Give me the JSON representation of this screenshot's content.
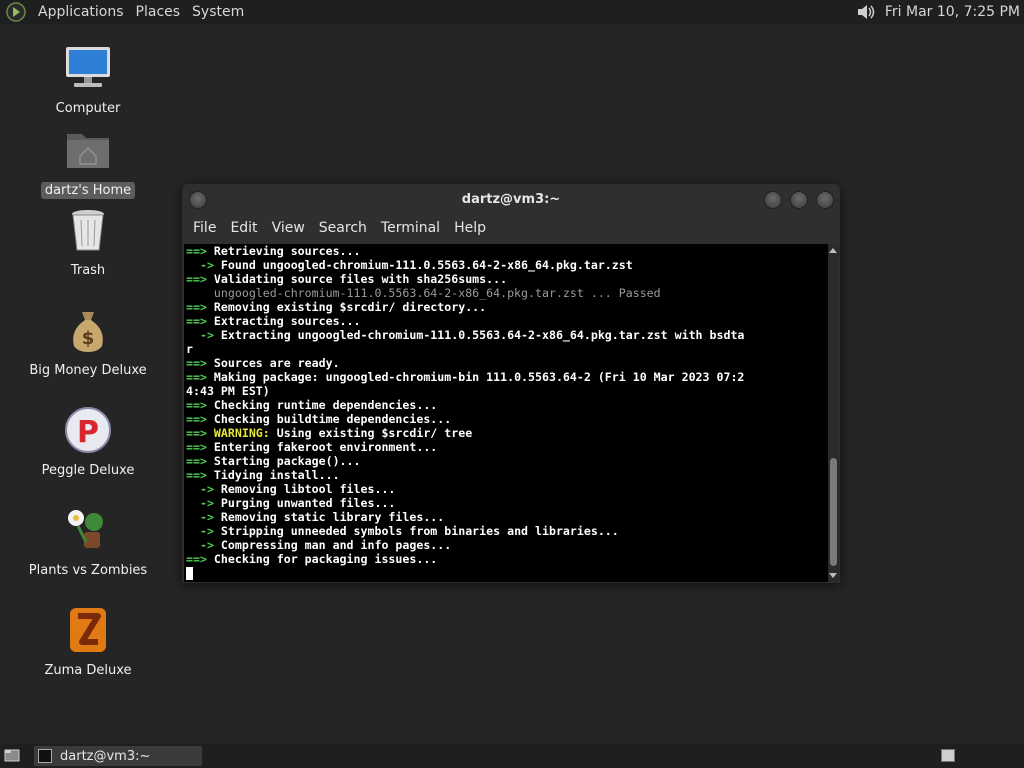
{
  "top_panel": {
    "menus": [
      "Applications",
      "Places",
      "System"
    ],
    "clock": "Fri Mar 10,  7:25 PM"
  },
  "desktop": {
    "icons": [
      {
        "label": "Computer",
        "icon": "computer-icon"
      },
      {
        "label": "dartz's Home",
        "icon": "home-folder-icon"
      },
      {
        "label": "Trash",
        "icon": "trash-icon"
      },
      {
        "label": "Big Money Deluxe",
        "icon": "money-bag-icon"
      },
      {
        "label": "Peggle Deluxe",
        "icon": "peggle-icon"
      },
      {
        "label": "Plants vs Zombies",
        "icon": "plants-icon"
      },
      {
        "label": "Zuma Deluxe",
        "icon": "zuma-icon"
      }
    ]
  },
  "window": {
    "title": "dartz@vm3:~",
    "menu": [
      "File",
      "Edit",
      "View",
      "Search",
      "Terminal",
      "Help"
    ],
    "lines": [
      {
        "prefix": "==> ",
        "text": "Retrieving sources..."
      },
      {
        "prefix": "  -> ",
        "text": "Found ungoogled-chromium-111.0.5563.64-2-x86_64.pkg.tar.zst"
      },
      {
        "prefix": "==> ",
        "text": "Validating source files with sha256sums..."
      },
      {
        "prefix": "",
        "text": "    ungoogled-chromium-111.0.5563.64-2-x86_64.pkg.tar.zst ... Passed",
        "style": "dim"
      },
      {
        "prefix": "==> ",
        "text": "Removing existing $srcdir/ directory..."
      },
      {
        "prefix": "==> ",
        "text": "Extracting sources..."
      },
      {
        "prefix": "  -> ",
        "text": "Extracting ungoogled-chromium-111.0.5563.64-2-x86_64.pkg.tar.zst with bsdta"
      },
      {
        "prefix": "",
        "text": "r"
      },
      {
        "prefix": "==> ",
        "text": "Sources are ready."
      },
      {
        "prefix": "==> ",
        "text": "Making package: ungoogled-chromium-bin 111.0.5563.64-2 (Fri 10 Mar 2023 07:2"
      },
      {
        "prefix": "",
        "text": "4:43 PM EST)"
      },
      {
        "prefix": "==> ",
        "text": "Checking runtime dependencies..."
      },
      {
        "prefix": "==> ",
        "text": "Checking buildtime dependencies..."
      },
      {
        "prefix": "==> ",
        "warn": "WARNING:",
        "text": " Using existing $srcdir/ tree"
      },
      {
        "prefix": "==> ",
        "text": "Entering fakeroot environment..."
      },
      {
        "prefix": "==> ",
        "text": "Starting package()..."
      },
      {
        "prefix": "==> ",
        "text": "Tidying install..."
      },
      {
        "prefix": "  -> ",
        "text": "Removing libtool files..."
      },
      {
        "prefix": "  -> ",
        "text": "Purging unwanted files..."
      },
      {
        "prefix": "  -> ",
        "text": "Removing static library files..."
      },
      {
        "prefix": "  -> ",
        "text": "Stripping unneeded symbols from binaries and libraries..."
      },
      {
        "prefix": "  -> ",
        "text": "Compressing man and info pages..."
      },
      {
        "prefix": "==> ",
        "text": "Checking for packaging issues..."
      }
    ]
  },
  "bottom_panel": {
    "task_label": "dartz@vm3:~"
  }
}
